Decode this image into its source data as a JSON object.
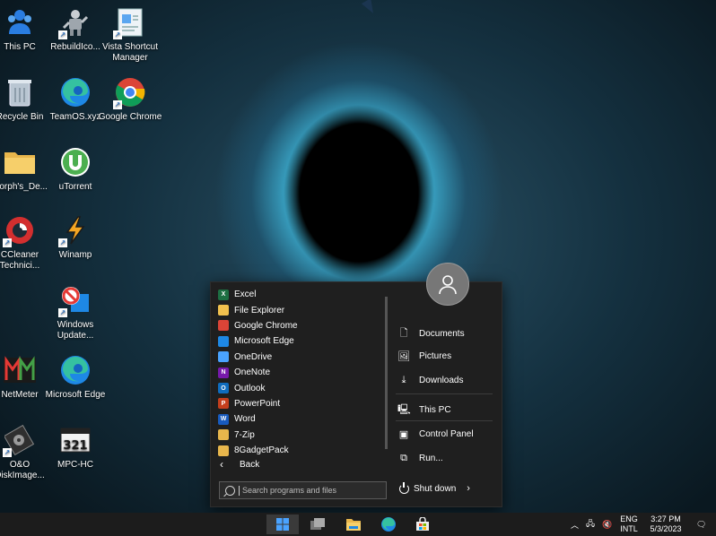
{
  "desktop": {
    "icons": [
      {
        "label": "This PC"
      },
      {
        "label": "RebuildIco..."
      },
      {
        "label": "Vista Shortcut Manager"
      },
      {
        "label": "Recycle Bin"
      },
      {
        "label": "TeamOS.xyz"
      },
      {
        "label": "Google Chrome"
      },
      {
        "label": "Morph's_De..."
      },
      {
        "label": "uTorrent"
      },
      {
        "label": "CCleaner Technici..."
      },
      {
        "label": "Winamp"
      },
      {
        "label": "Windows Update..."
      },
      {
        "label": "NetMeter"
      },
      {
        "label": "Microsoft Edge"
      },
      {
        "label": "O&O DiskImage..."
      },
      {
        "label": "MPC-HC"
      }
    ]
  },
  "start_menu": {
    "programs": [
      {
        "label": "Excel",
        "badge": "X",
        "color": "#1d6f42"
      },
      {
        "label": "File Explorer",
        "badge": "",
        "color": "#f2c14e"
      },
      {
        "label": "Google Chrome",
        "badge": "",
        "color": "#db4437"
      },
      {
        "label": "Microsoft Edge",
        "badge": "",
        "color": "#1e88e5"
      },
      {
        "label": "OneDrive",
        "badge": "",
        "color": "#4aa3ff"
      },
      {
        "label": "OneNote",
        "badge": "N",
        "color": "#7719aa"
      },
      {
        "label": "Outlook",
        "badge": "O",
        "color": "#0f6cbd"
      },
      {
        "label": "PowerPoint",
        "badge": "P",
        "color": "#c43e1c"
      },
      {
        "label": "Word",
        "badge": "W",
        "color": "#185abd"
      },
      {
        "label": "7-Zip",
        "badge": "",
        "color": "#e8b64c"
      },
      {
        "label": "8GadgetPack",
        "badge": "",
        "color": "#e8b64c"
      }
    ],
    "back_label": "Back",
    "search_placeholder": "Search programs and files",
    "places": {
      "documents": "Documents",
      "pictures": "Pictures",
      "downloads": "Downloads",
      "this_pc": "This PC",
      "control_panel": "Control Panel",
      "run": "Run..."
    },
    "shutdown_label": "Shut down"
  },
  "taskbar": {
    "lang_line1": "ENG",
    "lang_line2": "INTL",
    "time": "3:27 PM",
    "date": "5/3/2023"
  },
  "colors": {
    "accent": "#0078d4",
    "taskbar": "#1c1c1c",
    "menu": "#1f1f1f"
  }
}
